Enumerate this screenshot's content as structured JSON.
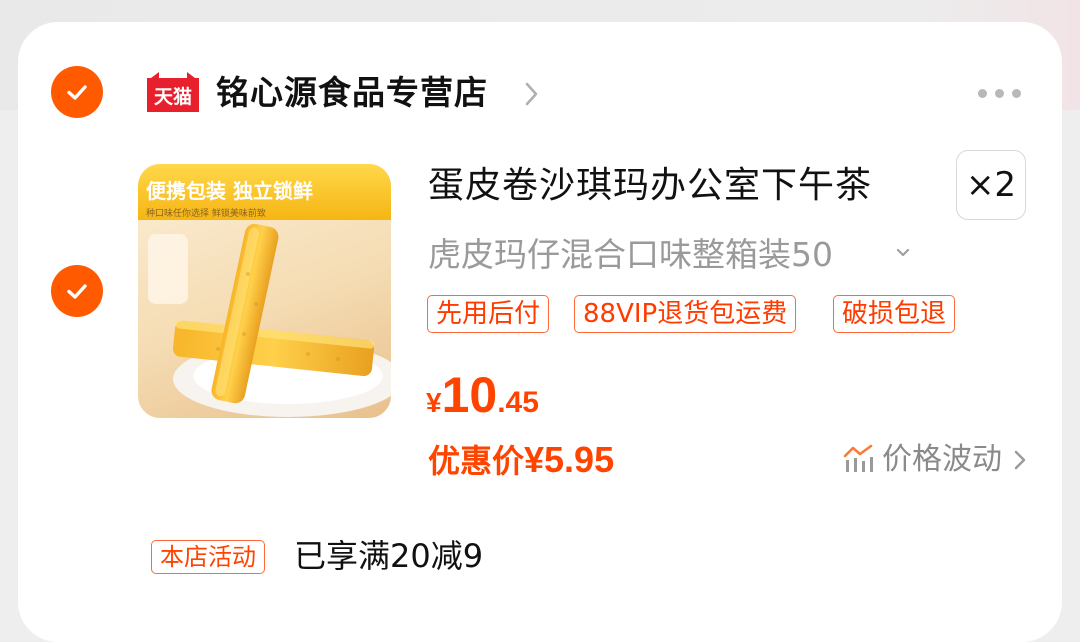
{
  "store": {
    "logo_text": "天猫",
    "name": "铭心源食品专营店"
  },
  "item": {
    "image_banner": "便携包装 独立锁鲜",
    "image_subtext": "种口味任你选择  鲜锁美味前致",
    "title": "蛋皮卷沙琪玛办公室下午茶",
    "quantity": "×2",
    "sku": "虎皮玛仔混合口味整箱装50",
    "tags": [
      "先用后付",
      "88VIP退货包运费",
      "破损包退"
    ],
    "price": {
      "symbol": "¥",
      "integer": "10",
      "decimal": ".45"
    },
    "coupon": {
      "label": "优惠价",
      "amount": "¥5.95"
    },
    "price_trend_label": "价格波动"
  },
  "promotion": {
    "tag": "本店活动",
    "text": "已享满20减9"
  },
  "colors": {
    "accent": "#ff4400",
    "check": "#ff5a00",
    "tmall_red": "#e8202e"
  }
}
